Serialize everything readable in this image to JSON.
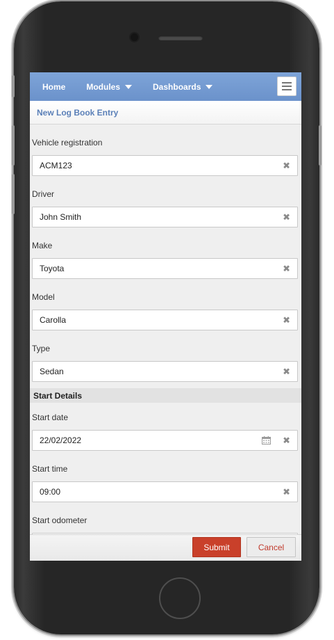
{
  "navbar": {
    "items": [
      {
        "label": "Home",
        "has_dropdown": false
      },
      {
        "label": "Modules",
        "has_dropdown": true
      },
      {
        "label": "Dashboards",
        "has_dropdown": true
      }
    ],
    "menu_icon": "hamburger-icon"
  },
  "page": {
    "title": "New Log Book Entry"
  },
  "form": {
    "vehicle_registration": {
      "label": "Vehicle registration",
      "value": "ACM123"
    },
    "driver": {
      "label": "Driver",
      "value": "John Smith"
    },
    "make": {
      "label": "Make",
      "value": "Toyota"
    },
    "model": {
      "label": "Model",
      "value": "Carolla"
    },
    "type": {
      "label": "Type",
      "value": "Sedan"
    },
    "start_section": {
      "title": "Start Details"
    },
    "start_date": {
      "label": "Start date",
      "value": "22/02/2022"
    },
    "start_time": {
      "label": "Start time",
      "value": "09:00"
    },
    "start_odometer": {
      "label": "Start odometer",
      "value": ""
    }
  },
  "footer": {
    "submit_label": "Submit",
    "cancel_label": "Cancel"
  },
  "icons": {
    "clear": "close-icon",
    "calendar": "calendar-icon",
    "dropdown": "caret-down-icon"
  },
  "colors": {
    "navbar": "#6b92cb",
    "title": "#5b80b8",
    "submit": "#c9402a",
    "cancel_text": "#c0392b"
  }
}
